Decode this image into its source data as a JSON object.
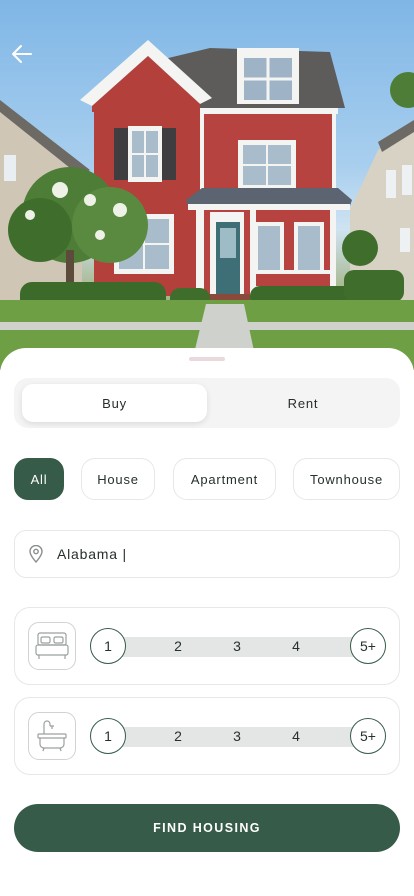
{
  "hero": {
    "image_alt": "Red two-story house with white trim and front porch"
  },
  "nav": {
    "back_icon": "arrow-left-icon"
  },
  "segment": {
    "options": [
      {
        "label": "Buy",
        "selected": true
      },
      {
        "label": "Rent",
        "selected": false
      }
    ]
  },
  "property_types": [
    {
      "label": "All",
      "selected": true
    },
    {
      "label": "House",
      "selected": false
    },
    {
      "label": "Apartment",
      "selected": false
    },
    {
      "label": "Townhouse",
      "selected": false
    }
  ],
  "location": {
    "icon": "location-pin-icon",
    "value": "Alabama |"
  },
  "bedrooms": {
    "icon": "bed-icon",
    "options": [
      "1",
      "2",
      "3",
      "4",
      "5+"
    ]
  },
  "bathrooms": {
    "icon": "bathtub-icon",
    "options": [
      "1",
      "2",
      "3",
      "4",
      "5+"
    ]
  },
  "cta": {
    "label": "FIND HOUSING"
  },
  "colors": {
    "accent": "#365b48",
    "house_red": "#b4403b"
  }
}
